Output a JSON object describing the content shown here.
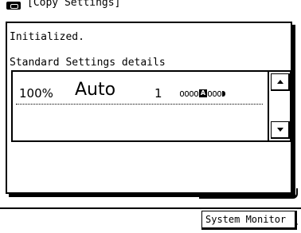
{
  "background": {
    "header_title": "[Copy Settings]"
  },
  "dialog": {
    "status_text": "Initialized.",
    "subtitle": "Standard Settings details",
    "detail_row": {
      "zoom": "100%",
      "color_mode": "Auto",
      "copies": "1",
      "density_icon": "density-scale-icon",
      "density_letter": "A"
    },
    "scroll_up_icon": "triangle-up-icon",
    "scroll_down_icon": "triangle-down-icon"
  },
  "bottom_bar": {
    "system_monitor_label": "System Monitor",
    "arrow_icon": "triangle-right-icon"
  },
  "colors": {
    "foreground": "#000000",
    "background": "#ffffff"
  }
}
